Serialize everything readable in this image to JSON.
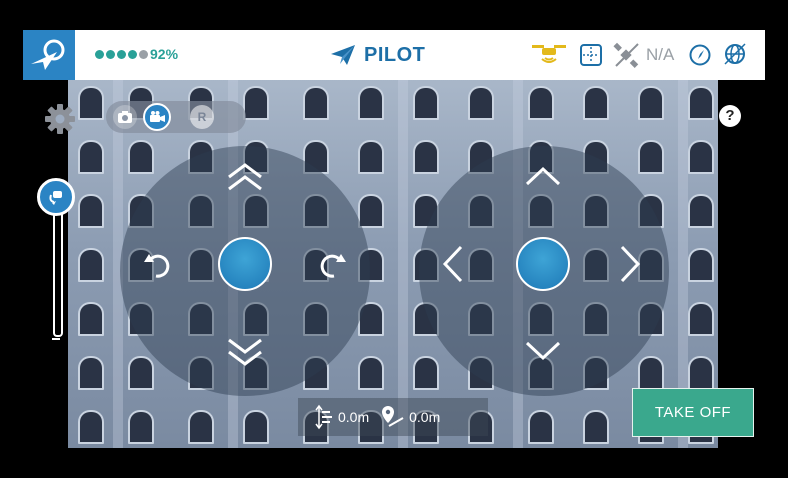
{
  "app": {
    "title": "PILOT",
    "brand_color": "#2b84c4",
    "accent_color": "#2aa198",
    "logo_icon": "paper-plane-logo"
  },
  "status_bar": {
    "battery": {
      "level_dots_filled": 4,
      "level_dots_total": 5,
      "percent_text": "92%"
    },
    "icons": [
      "drone-signal-icon",
      "grid-icon",
      "satellite-icon",
      "compass-icon",
      "globe-target-icon"
    ],
    "gps_text": "N/A"
  },
  "controls": {
    "settings_icon": "gear-icon",
    "mode_toggle": {
      "photo_icon": "camera-icon",
      "video_icon": "video-camera-icon",
      "record_label": "R",
      "selected": "video"
    },
    "help_label": "?",
    "altitude_slider": {
      "icon": "drone-arrow-icon",
      "level": 0.0
    }
  },
  "joysticks": {
    "left": {
      "icons": [
        "double-chevron-up-icon",
        "rotate-left-icon",
        "rotate-right-icon",
        "double-chevron-down-icon"
      ]
    },
    "right": {
      "icons": [
        "chevron-up-icon",
        "chevron-left-icon",
        "chevron-right-icon",
        "chevron-down-icon"
      ]
    }
  },
  "telemetry": {
    "height_value": "0.0m",
    "distance_value": "0.0m"
  },
  "takeoff_button": {
    "label": "TAKE OFF"
  }
}
